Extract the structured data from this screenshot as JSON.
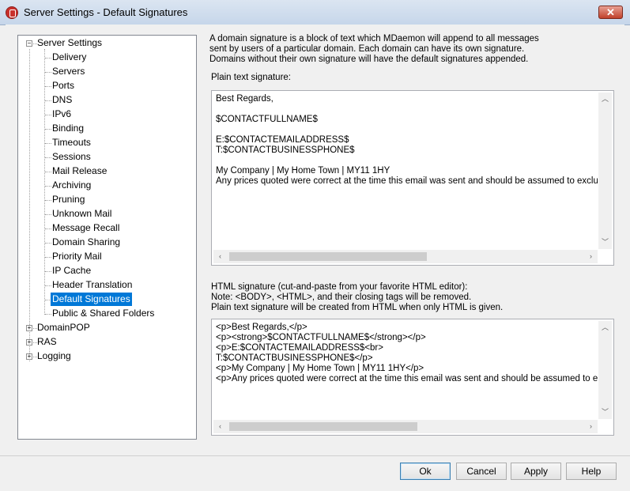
{
  "window": {
    "title": "Server Settings - Default Signatures",
    "close_label": "✕"
  },
  "tree": {
    "root": {
      "label": "Server Settings",
      "expander": "−"
    },
    "children": [
      {
        "label": "Delivery"
      },
      {
        "label": "Servers"
      },
      {
        "label": "Ports"
      },
      {
        "label": "DNS"
      },
      {
        "label": "IPv6"
      },
      {
        "label": "Binding"
      },
      {
        "label": "Timeouts"
      },
      {
        "label": "Sessions"
      },
      {
        "label": "Mail Release"
      },
      {
        "label": "Archiving"
      },
      {
        "label": "Pruning"
      },
      {
        "label": "Unknown Mail"
      },
      {
        "label": "Message Recall"
      },
      {
        "label": "Domain Sharing"
      },
      {
        "label": "Priority Mail"
      },
      {
        "label": "IP Cache"
      },
      {
        "label": "Header Translation"
      },
      {
        "label": "Default Signatures",
        "selected": true
      },
      {
        "label": "Public & Shared Folders"
      }
    ],
    "other_roots": [
      {
        "label": "DomainPOP",
        "expander": "+"
      },
      {
        "label": "RAS",
        "expander": "+"
      },
      {
        "label": "Logging",
        "expander": "+"
      }
    ]
  },
  "description": {
    "line1": "A domain signature is a block of text which MDaemon will append to all messages",
    "line2": "sent by users of a particular domain.  Each domain can have its own signature.",
    "line3": "Domains without their own signature will have the default signatures appended."
  },
  "plain": {
    "label": "Plain text signature:",
    "text": "Best Regards,\n\n$CONTACTFULLNAME$\n\nE:$CONTACTEMAILADDRESS$\nT:$CONTACTBUSINESSPHONE$\n\nMy Company | My Home Town | MY11 1HY\nAny prices quoted were correct at the time this email was sent and should be assumed to exclude VAT"
  },
  "html": {
    "label1": "HTML signature (cut-and-paste from your favorite HTML editor):",
    "label2": "Note: <BODY>, <HTML>, and their closing tags will be removed.",
    "label3": "Plain text signature will be created from HTML when only HTML is given.",
    "text": "<p>Best Regards,</p>\n<p><strong>$CONTACTFULLNAME$</strong></p>\n<p>E:$CONTACTEMAILADDRESS$<br>\nT:$CONTACTBUSINESSPHONE$</p>\n<p>My Company | My Home Town | MY11 1HY</p>\n<p>Any prices quoted were correct at the time this email was sent and should be assumed to exclude V"
  },
  "buttons": {
    "ok": "Ok",
    "cancel": "Cancel",
    "apply": "Apply",
    "help": "Help"
  },
  "colors": {
    "selection": "#0078d7",
    "close": "#c0412b"
  }
}
